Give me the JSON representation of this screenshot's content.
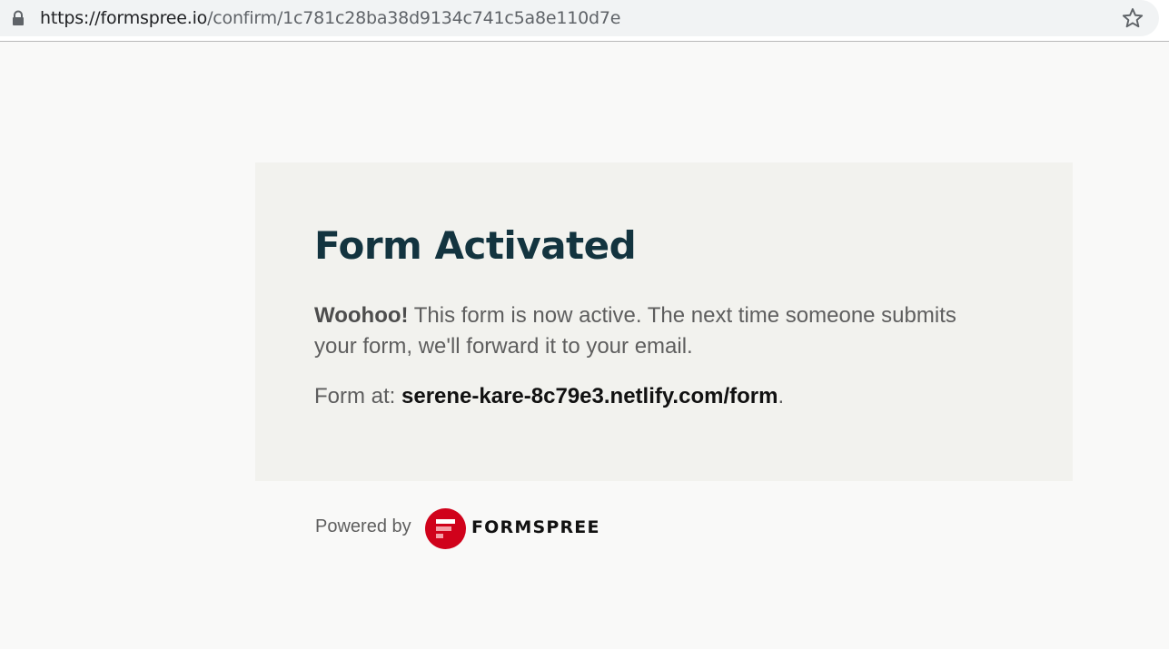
{
  "browser": {
    "url_host": "https://formspree.io",
    "url_path": "/confirm/1c781c28ba38d9134c741c5a8e110d7e",
    "lock_icon": "lock-icon",
    "bookmark_icon": "star-icon"
  },
  "card": {
    "title": "Form Activated",
    "message_bold": "Woohoo!",
    "message_rest": " This form is now active. The next time someone submits your form, we'll forward it to your email.",
    "form_at_label": "Form at: ",
    "form_at_site": "serene-kare-8c79e3.netlify.com/form",
    "form_at_end": "."
  },
  "footer": {
    "powered_by": "Powered by",
    "brand": "FORMSPREE",
    "brand_color": "#d0021b"
  },
  "colors": {
    "page_bg": "#f9f9f8",
    "card_bg": "#f2f2ee",
    "title_color": "#13343f"
  }
}
